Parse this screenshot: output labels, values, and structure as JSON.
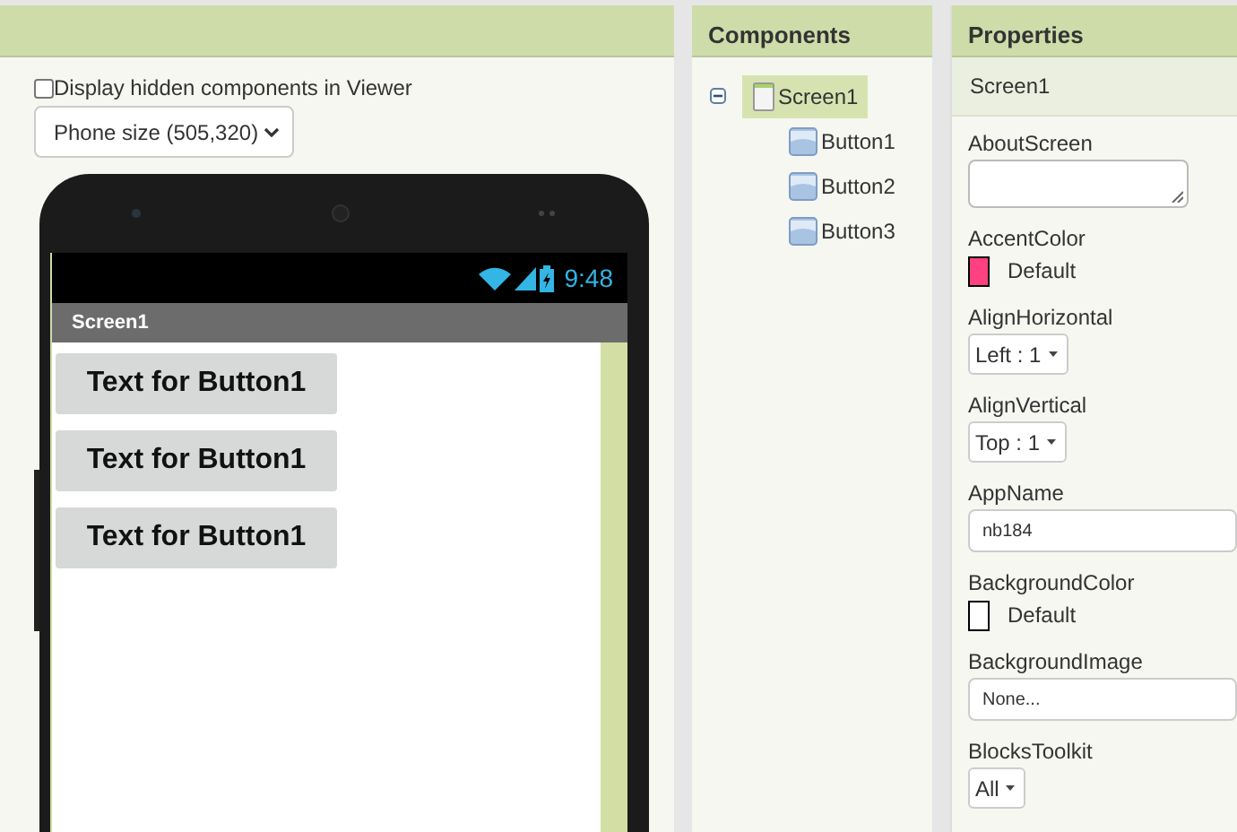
{
  "viewer": {
    "hidden_checkbox": {
      "label": "Display hidden components in Viewer",
      "checked": false
    },
    "size_select": {
      "value": "Phone size (505,320)"
    },
    "phone": {
      "time": "9:48",
      "screen_title": "Screen1",
      "buttons": [
        "Text for Button1",
        "Text for Button1",
        "Text for Button1"
      ]
    }
  },
  "components": {
    "title": "Components",
    "tree": [
      {
        "label": "Screen1",
        "selected": true,
        "expanded": true,
        "children": [
          {
            "label": "Button1",
            "selected": false
          },
          {
            "label": "Button2",
            "selected": false
          },
          {
            "label": "Button3",
            "selected": false
          }
        ]
      }
    ]
  },
  "properties": {
    "title": "Properties",
    "component": "Screen1",
    "items": [
      {
        "kind": "textarea",
        "label": "AboutScreen"
      },
      {
        "kind": "color",
        "label": "AccentColor",
        "value": "Default",
        "color": "#ff4081"
      },
      {
        "kind": "dropdown",
        "label": "AlignHorizontal",
        "value": "Left : 1"
      },
      {
        "kind": "dropdown",
        "label": "AlignVertical",
        "value": "Top : 1"
      },
      {
        "kind": "text",
        "label": "AppName",
        "value": "nb184"
      },
      {
        "kind": "color",
        "label": "BackgroundColor",
        "value": "Default",
        "color": "#ffffff"
      },
      {
        "kind": "text",
        "label": "BackgroundImage",
        "value": "None..."
      },
      {
        "kind": "dropdown",
        "label": "BlocksToolkit",
        "value": "All"
      }
    ]
  }
}
